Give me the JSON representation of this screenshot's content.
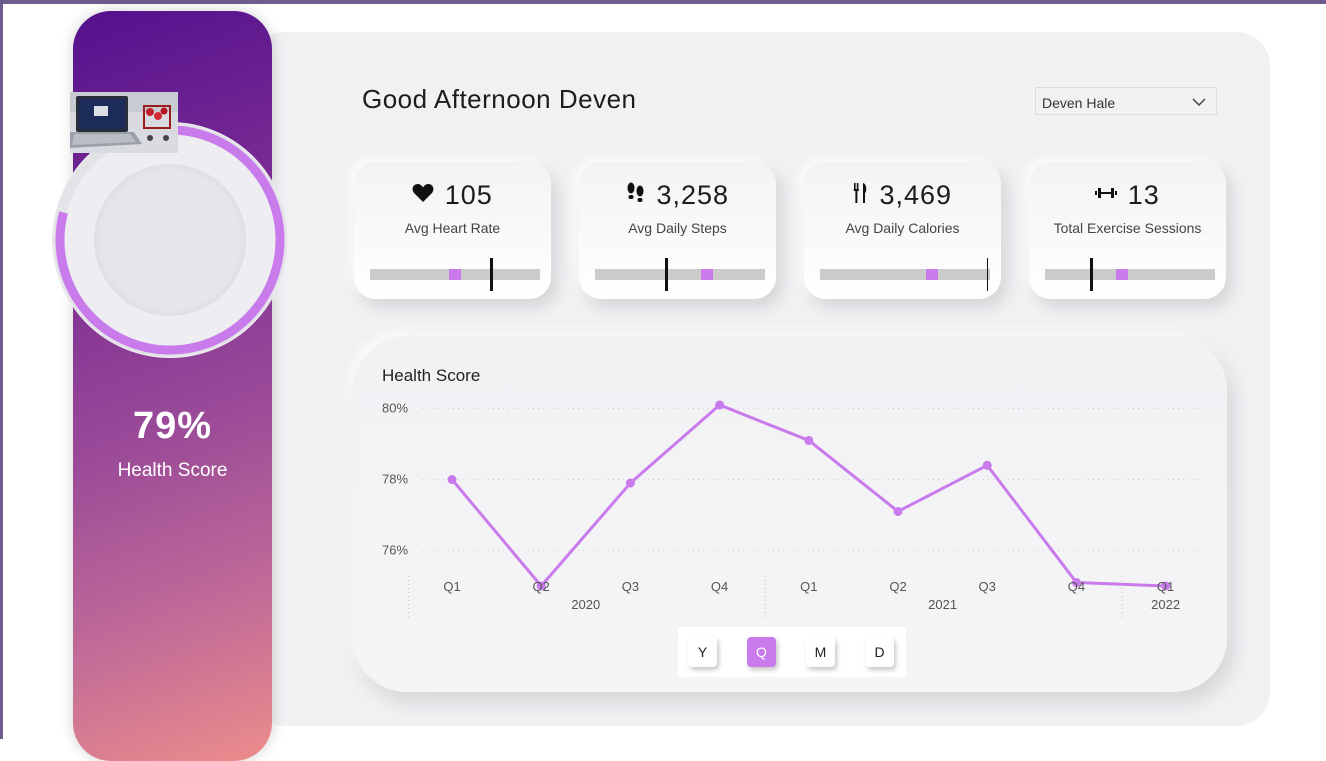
{
  "sidebar": {
    "score_value": "79%",
    "score_label": "Health Score",
    "score_fraction": 0.79
  },
  "header": {
    "greeting": "Good Afternoon Deven",
    "user_select": {
      "selected": "Deven Hale"
    }
  },
  "kpis": [
    {
      "value": "105",
      "label": "Avg Heart Rate",
      "icon": "heart-icon",
      "actual_fraction": 0.5,
      "target_fraction": 0.71
    },
    {
      "value": "3,258",
      "label": "Avg Daily Steps",
      "icon": "footprints-icon",
      "actual_fraction": 0.66,
      "target_fraction": 0.42
    },
    {
      "value": "3,469",
      "label": "Avg Daily Calories",
      "icon": "fork-knife-icon",
      "actual_fraction": 0.66,
      "target_fraction": 0.99
    },
    {
      "value": "13",
      "label": "Total Exercise Sessions",
      "icon": "dumbbell-icon",
      "actual_fraction": 0.45,
      "target_fraction": 0.27
    }
  ],
  "colors": {
    "accent": "#c97bec",
    "track": "#cbcbcb",
    "target_marker": "#111111"
  },
  "chart": {
    "title": "Health Score",
    "granularity_buttons": [
      "Y",
      "Q",
      "M",
      "D"
    ],
    "active_granularity": "Q"
  },
  "chart_data": {
    "type": "line",
    "title": "Health Score",
    "categories": [
      "Q1",
      "Q2",
      "Q3",
      "Q4",
      "Q1",
      "Q2",
      "Q3",
      "Q4",
      "Q1"
    ],
    "years": [
      {
        "label": "2020",
        "span": [
          0,
          3
        ]
      },
      {
        "label": "2021",
        "span": [
          4,
          7
        ]
      },
      {
        "label": "2022",
        "span": [
          8,
          8
        ]
      }
    ],
    "series": [
      {
        "values": [
          78.0,
          75.0,
          77.9,
          80.1,
          79.1,
          77.1,
          78.4,
          75.1,
          75.0
        ]
      }
    ],
    "yticks": [
      76,
      78,
      80
    ],
    "ytick_labels": [
      "76%",
      "78%",
      "80%"
    ],
    "ylim": [
      75,
      81
    ],
    "grid": true
  }
}
